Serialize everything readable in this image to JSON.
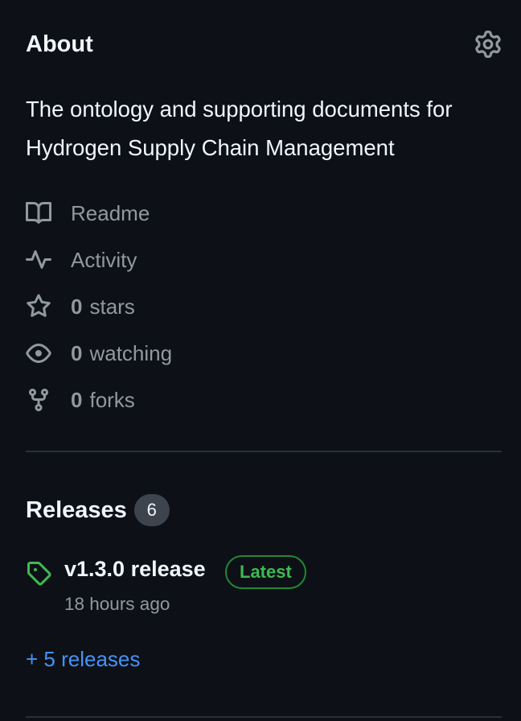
{
  "about": {
    "title": "About",
    "description": "The ontology and supporting documents for Hydrogen Supply Chain Management"
  },
  "meta": {
    "readme": "Readme",
    "activity": "Activity",
    "stars_count": "0",
    "stars_label": "stars",
    "watching_count": "0",
    "watching_label": "watching",
    "forks_count": "0",
    "forks_label": "forks"
  },
  "releases": {
    "title": "Releases",
    "count": "6",
    "latest_name": "v1.3.0 release",
    "latest_badge": "Latest",
    "latest_time": "18 hours ago",
    "more_link": "+ 5 releases"
  },
  "colors": {
    "background": "#0d1117",
    "text": "#f0f6fc",
    "muted": "#9198a1",
    "link": "#4493f8",
    "success": "#3fb950"
  },
  "icons": [
    "gear-icon",
    "book-icon",
    "pulse-icon",
    "star-icon",
    "eye-icon",
    "repo-forked-icon",
    "tag-icon"
  ]
}
